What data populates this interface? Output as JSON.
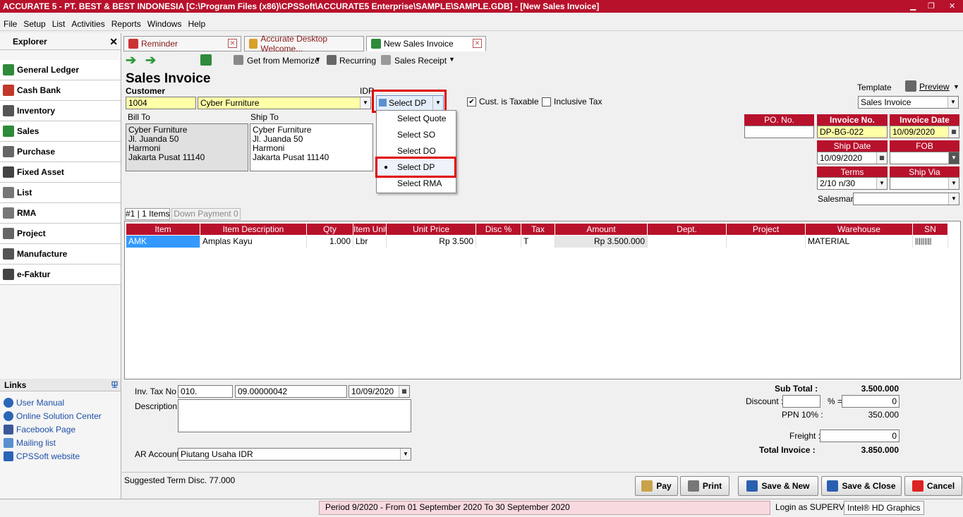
{
  "window": {
    "title": "ACCURATE 5  -  PT. BEST & BEST INDONESIA   [C:\\Program Files (x86)\\CPSSoft\\ACCURATE5 Enterprise\\SAMPLE\\SAMPLE.GDB] - [New Sales Invoice]",
    "accent": "#b8112c"
  },
  "menu": [
    "File",
    "Setup",
    "List",
    "Activities",
    "Reports",
    "Windows",
    "Help"
  ],
  "explorer": {
    "title": "Explorer",
    "close": "✕",
    "items": [
      "General Ledger",
      "Cash Bank",
      "Inventory",
      "Sales",
      "Purchase",
      "Fixed Asset",
      "List",
      "RMA",
      "Project",
      "Manufacture",
      "e-Faktur"
    ]
  },
  "links": {
    "title": "Links",
    "items": [
      "User Manual",
      "Online Solution Center",
      "Facebook Page",
      "Mailing list",
      "CPSSoft website"
    ]
  },
  "tabs": [
    "Reminder",
    "Accurate Desktop Welcome...",
    "New Sales Invoice"
  ],
  "toolbar": {
    "memorize": "Get from Memorize",
    "recurring": "Recurring",
    "receipt": "Sales Receipt"
  },
  "form": {
    "title": "Sales Invoice",
    "customer_label": "Customer",
    "customer_code": "1004",
    "customer_name": "Cyber Furniture",
    "currency": "IDR",
    "select_button": "Select DP",
    "cust_taxable": "Cust. is Taxable",
    "inclusive_tax": "Inclusive Tax",
    "template_label": "Template",
    "template_value": "Sales Invoice",
    "preview": "Preview",
    "bill_to_label": "Bill To",
    "ship_to_label": "Ship To",
    "bill_to": [
      "Cyber Furniture",
      "Jl. Juanda 50",
      "Harmoni",
      "Jakarta Pusat 11140"
    ],
    "ship_to": [
      "Cyber Furniture",
      "Jl. Juanda 50",
      "Harmoni",
      "Jakarta Pusat 11140"
    ],
    "po_label": "PO. No.",
    "po_value": "",
    "invoice_no_label": "Invoice No.",
    "invoice_no": "DP-BG-022",
    "invoice_date_label": "Invoice Date",
    "invoice_date": "10/09/2020",
    "ship_date_label": "Ship Date",
    "ship_date": "10/09/2020",
    "fob_label": "FOB",
    "fob_value": "",
    "terms_label": "Terms",
    "terms_value": "2/10 n/30",
    "ship_via_label": "Ship Via",
    "ship_via_value": "",
    "salesman_label": "Salesman",
    "salesman_value": ""
  },
  "popup": {
    "items": [
      "Select Quote",
      "Select SO",
      "Select DO",
      "Select DP",
      "Select RMA"
    ],
    "selected_index": 3
  },
  "grid": {
    "tabs": [
      "#1 | 1 Items",
      "Down Payment   0"
    ],
    "headers": [
      "Item",
      "Item Description",
      "Qty",
      "Item Unit",
      "Unit Price",
      "Disc %",
      "Tax",
      "Amount",
      "Dept.",
      "Project",
      "Warehouse",
      "SN"
    ],
    "rows": [
      [
        "AMK",
        "Amplas Kayu",
        "1.000",
        "Lbr",
        "Rp 3.500",
        "",
        "T",
        "Rp 3.500.000",
        "",
        "",
        "MATERIAL",
        "|||||||||"
      ]
    ]
  },
  "footer": {
    "inv_tax_label": "Inv. Tax No",
    "inv_tax_1": "010.",
    "inv_tax_2": "09.00000042",
    "inv_tax_date": "10/09/2020",
    "description_label": "Description:",
    "description": "",
    "ar_account_label": "AR Account",
    "ar_account": "Piutang Usaha IDR",
    "subtotal_label": "Sub Total :",
    "subtotal": "3.500.000",
    "discount_label": "Discount :",
    "discount_pct": "",
    "pct_eq": "% =",
    "discount_value": "0",
    "ppn_label": "PPN 10% :",
    "ppn_value": "350.000",
    "freight_label": "Freight :",
    "freight_value": "0",
    "total_label": "Total Invoice :",
    "total_value": "3.850.000",
    "suggested": "Suggested Term Disc. 77.000"
  },
  "buttons": {
    "pay": "Pay",
    "print": "Print",
    "save_new": "Save & New",
    "save_close": "Save & Close",
    "cancel": "Cancel"
  },
  "status": {
    "period": "Period 9/2020 - From 01 September 2020 To 30 September 2020",
    "login": "Login as SUPERVIS",
    "graphics": "Intel® HD Graphics"
  }
}
